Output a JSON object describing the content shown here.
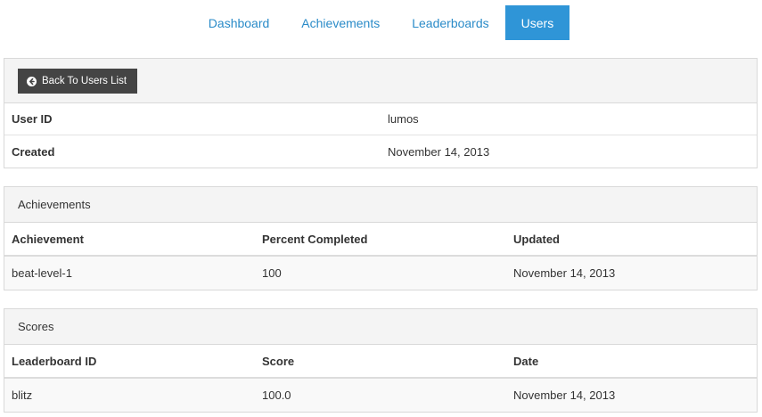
{
  "nav": {
    "items": [
      {
        "label": "Dashboard",
        "active": false
      },
      {
        "label": "Achievements",
        "active": false
      },
      {
        "label": "Leaderboards",
        "active": false
      },
      {
        "label": "Users",
        "active": true
      }
    ]
  },
  "user": {
    "back_label": "Back To Users List",
    "back_icon": "circle-arrow-left-icon",
    "fields": [
      {
        "key": "User ID",
        "value": "lumos"
      },
      {
        "key": "Created",
        "value": "November 14, 2013"
      }
    ]
  },
  "achievements": {
    "title": "Achievements",
    "columns": [
      "Achievement",
      "Percent Completed",
      "Updated"
    ],
    "rows": [
      [
        "beat-level-1",
        "100",
        "November 14, 2013"
      ]
    ]
  },
  "scores": {
    "title": "Scores",
    "columns": [
      "Leaderboard ID",
      "Score",
      "Date"
    ],
    "rows": [
      [
        "blitz",
        "100.0",
        "November 14, 2013"
      ]
    ]
  },
  "colors": {
    "accent": "#2f95d7",
    "link": "#2a8bc8",
    "button": "#444444"
  }
}
